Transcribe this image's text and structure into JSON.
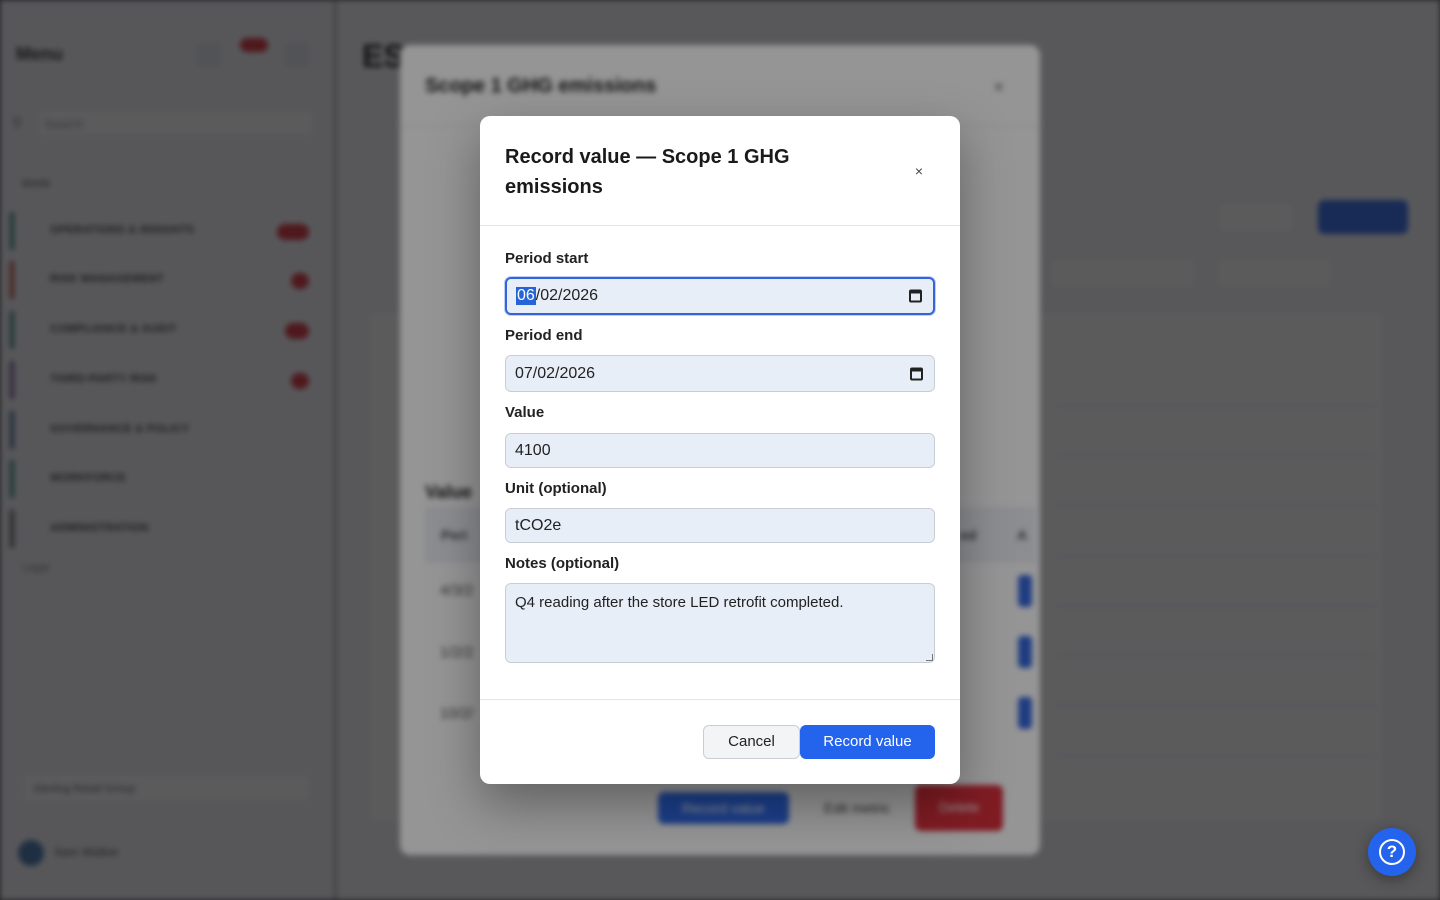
{
  "background": {
    "sidebar": {
      "title": "Menu",
      "search_placeholder": "Search",
      "section": "MAIN",
      "items": [
        {
          "label": "OPERATIONS & INSIGHTS"
        },
        {
          "label": "RISK MANAGEMENT"
        },
        {
          "label": "COMPLIANCE & AUDIT"
        },
        {
          "label": "THIRD-PARTY RISK"
        },
        {
          "label": "GOVERNANCE & POLICY"
        },
        {
          "label": "WORKFORCE"
        },
        {
          "label": "ADMINISTRATION"
        }
      ],
      "footer": "Legal",
      "workspace": "Sterling Retail Group",
      "user": "Sam Walker"
    },
    "main": {
      "title": "ES",
      "details_title": "Scope 1 GHG emissions",
      "values_heading": "Value",
      "table_headers": [
        "Peri",
        "ed",
        "A"
      ],
      "rows": [
        "4/3/2",
        "1/2/2",
        "10/2/"
      ],
      "footer_buttons": {
        "record": "Record value",
        "edit": "Edit metric",
        "delete": "Delete"
      }
    }
  },
  "dialog": {
    "title": "Record value — Scope 1 GHG emissions",
    "close_symbol": "×",
    "period_start": {
      "label": "Period start",
      "month_selected": "06",
      "rest": "/02/2026"
    },
    "period_end": {
      "label": "Period end",
      "value": "07/02/2026"
    },
    "value": {
      "label": "Value",
      "value": "4100"
    },
    "unit": {
      "label": "Unit (optional)",
      "value": "tCO2e"
    },
    "notes": {
      "label": "Notes (optional)",
      "value": "Q4 reading after the store LED retrofit completed."
    },
    "buttons": {
      "cancel": "Cancel",
      "submit": "Record value"
    }
  },
  "help": {
    "symbol": "?"
  },
  "colors": {
    "primary": "#2463eb",
    "field_bg": "#e8eef7",
    "danger": "#d9232e"
  }
}
